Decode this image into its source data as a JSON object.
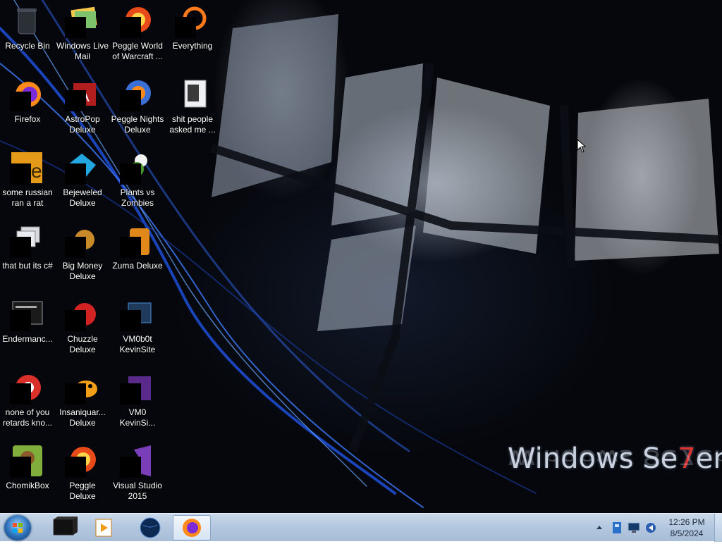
{
  "wallpaper": {
    "brand_main": "Windows Se",
    "brand_seven": "7",
    "brand_end": "en"
  },
  "icons": [
    {
      "label": "Recycle Bin",
      "icon": "recycle-bin-icon"
    },
    {
      "label": "Windows Live Mail",
      "icon": "mail-icon"
    },
    {
      "label": "Peggle World of Warcraft ...",
      "icon": "peggle-icon"
    },
    {
      "label": "Everything",
      "icon": "search-tool-icon"
    },
    {
      "label": "Firefox",
      "icon": "firefox-icon"
    },
    {
      "label": "AstroPop Deluxe",
      "icon": "astropop-icon"
    },
    {
      "label": "Peggle Nights Deluxe",
      "icon": "peggle-icon"
    },
    {
      "label": "shit people asked me ...",
      "icon": "folder-icon"
    },
    {
      "label": "some russian ran a rat",
      "icon": "document-icon"
    },
    {
      "label": "Bejeweled Deluxe",
      "icon": "bejeweled-icon"
    },
    {
      "label": "Plants vs Zombies",
      "icon": "plants-icon"
    },
    {
      "label": "that but its c#",
      "icon": "folder-icon"
    },
    {
      "label": "Big Money Deluxe",
      "icon": "money-icon"
    },
    {
      "label": "Zuma Deluxe",
      "icon": "zuma-icon"
    },
    {
      "label": "Endermanc...",
      "icon": "terminal-icon"
    },
    {
      "label": "Chuzzle Deluxe",
      "icon": "chuzzle-icon"
    },
    {
      "label": "VM0b0t KevinSite",
      "icon": "vm-icon"
    },
    {
      "label": "none of you retards kno...",
      "icon": "chrome-icon"
    },
    {
      "label": "Insaniquar... Deluxe",
      "icon": "fish-icon"
    },
    {
      "label": "VM0 KevinSi...",
      "icon": "vm-icon"
    },
    {
      "label": "ChomikBox",
      "icon": "chomikbox-icon"
    },
    {
      "label": "Peggle Deluxe",
      "icon": "peggle-icon"
    },
    {
      "label": "Visual Studio 2015",
      "icon": "visual-studio-icon"
    }
  ],
  "taskbar": {
    "start": "start-orb-icon",
    "pinned": [
      "terminal-icon",
      "media-player-icon",
      "globe-icon",
      "firefox-icon"
    ],
    "tray_icons": [
      "show-hidden-icons-icon",
      "network-icon",
      "display-icon",
      "volume-icon"
    ],
    "time": "12:26 PM",
    "date": "8/5/2024"
  },
  "colors": {
    "taskbar": "#b3c7df",
    "accent": "#2a6fb8"
  }
}
